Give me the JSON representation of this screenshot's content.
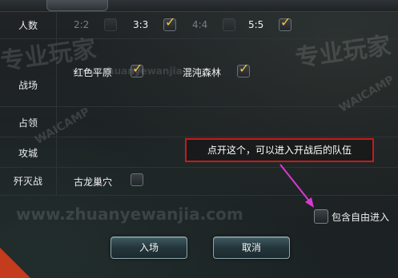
{
  "tabs": {
    "partial_label": ""
  },
  "rows": {
    "players": {
      "label": "人数",
      "options": [
        {
          "label": "2:2",
          "checked": false,
          "enabled": false
        },
        {
          "label": "3:3",
          "checked": true,
          "enabled": true
        },
        {
          "label": "4:4",
          "checked": false,
          "enabled": false
        },
        {
          "label": "5:5",
          "checked": true,
          "enabled": true
        }
      ]
    },
    "battlefield": {
      "label": "战场",
      "options": [
        {
          "label": "红色平原",
          "checked": true
        },
        {
          "label": "混沌森林",
          "checked": true
        }
      ]
    },
    "occupy": {
      "label": "占领"
    },
    "siege": {
      "label": "攻城"
    },
    "annihilation": {
      "label": "歼灭战",
      "options": [
        {
          "label": "古龙巢穴",
          "checked": false
        }
      ]
    }
  },
  "annotation": {
    "text": "点开这个，可以进入开战后的队伍",
    "border_color": "#c81a1a",
    "arrow_color": "#d63ad0"
  },
  "include_free_join": {
    "label": "包含自由进入",
    "checked": false
  },
  "buttons": {
    "enter": "入场",
    "cancel": "取消"
  },
  "watermarks": [
    "专业玩家",
    "www.zhuanyewanjia.com",
    "专业玩家",
    "www.zhuanyewanjia.com",
    "WAICAMP",
    "WAICAMP"
  ]
}
